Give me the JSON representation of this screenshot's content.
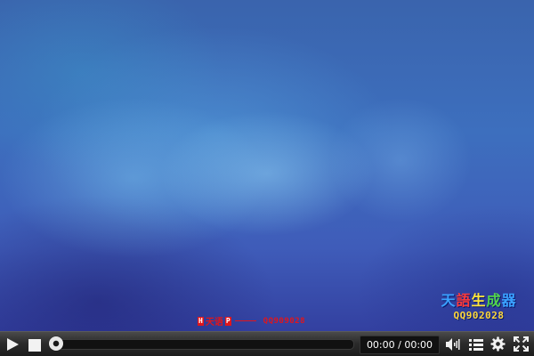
{
  "player": {
    "time_display": "00:00 / 00:00",
    "progress": 0
  },
  "overlay": {
    "stamp_left_boxes": [
      "H",
      "F",
      "P"
    ],
    "stamp_middle_text": "天语",
    "stamp_qq": "QQ909028",
    "logo_title_chars": [
      "天",
      "語",
      "生",
      "成",
      "器"
    ],
    "logo_qq": "QQ902028"
  },
  "icons": {
    "play": "play-icon",
    "stop": "stop-icon",
    "volume": "volume-icon",
    "playlist": "playlist-icon",
    "settings": "gear-icon",
    "fullscreen": "fullscreen-icon"
  }
}
